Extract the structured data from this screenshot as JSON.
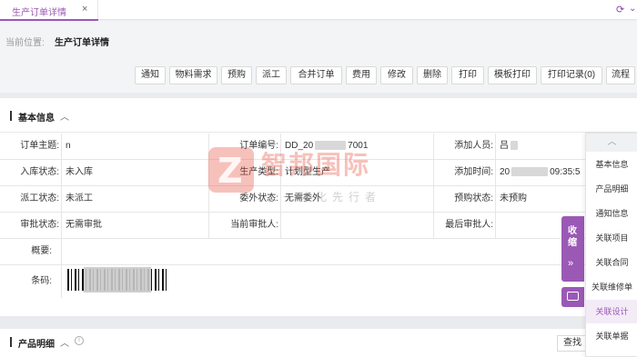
{
  "tabbar": {
    "tab_label": "生产订单详情",
    "close": "×",
    "refresh": "⟳",
    "menu": "⌄"
  },
  "breadcrumb": {
    "label": "当前位置:",
    "value": "生产订单详情"
  },
  "toolbar": {
    "buttons": [
      "通知",
      "物料需求",
      "预购",
      "派工",
      "合并订单",
      "费用",
      "修改",
      "删除",
      "打印",
      "模板打印",
      "打印记录(0)",
      "流程"
    ]
  },
  "basic_info": {
    "title": "基本信息",
    "chevron": "︿",
    "rows": [
      [
        {
          "label": "订单主题:",
          "value": "n"
        },
        {
          "label": "订单编号:",
          "value": "DD_20",
          "value_tail": "7001"
        },
        {
          "label": "添加人员:",
          "value": "吕"
        }
      ],
      [
        {
          "label": "入库状态:",
          "value": "未入库"
        },
        {
          "label": "生产类型:",
          "value": "计划型生产"
        },
        {
          "label": "添加时间:",
          "value": "20",
          "value_tail": "09:35:5"
        }
      ],
      [
        {
          "label": "派工状态:",
          "value": "未派工"
        },
        {
          "label": "委外状态:",
          "value": "无需委外"
        },
        {
          "label": "预购状态:",
          "value": "未预购"
        }
      ],
      [
        {
          "label": "审批状态:",
          "value": "无需审批"
        },
        {
          "label": "当前审批人:",
          "value": ""
        },
        {
          "label": "最后审批人:",
          "value": ""
        }
      ]
    ],
    "summary_label": "概要:",
    "summary_value": "",
    "barcode_label": "条码:"
  },
  "product_detail": {
    "title": "产品明细",
    "chevron": "︿",
    "info": "i",
    "search_label": "查找"
  },
  "watermark": {
    "logo_letter": "Z",
    "name": "智邦国际",
    "slogan": "一体化先行者"
  },
  "collapse": {
    "label": "收缩",
    "arrow": "»"
  },
  "sidenav": {
    "up": "︿",
    "items": [
      "基本信息",
      "产品明细",
      "通知信息",
      "关联项目",
      "关联合同",
      "关联维修单",
      "关联设计",
      "关联单据"
    ],
    "active_index": 6
  },
  "colors": {
    "accent": "#9b59b6",
    "watermark_red": "#e84c3d"
  }
}
